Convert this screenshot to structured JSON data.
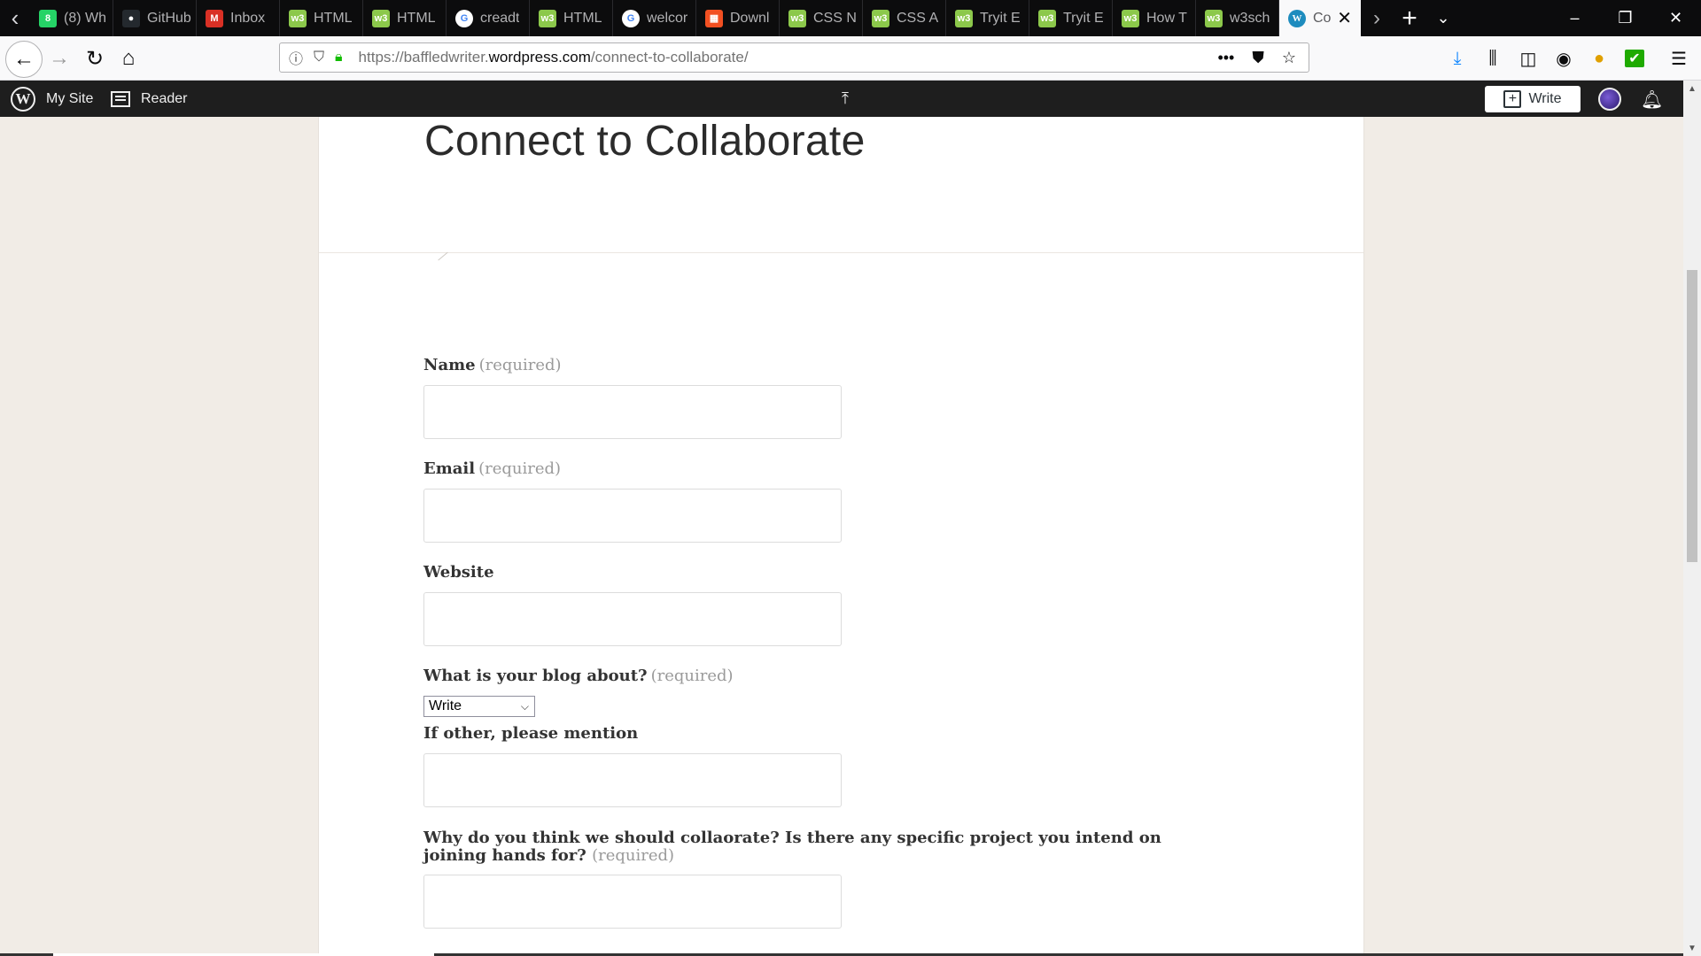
{
  "browser": {
    "tabs": [
      {
        "label": "(8) Wh",
        "icon": "whatsapp-icon",
        "color": "#25d366",
        "glyph": "8"
      },
      {
        "label": "GitHub",
        "icon": "github-icon",
        "color": "#24292e",
        "glyph": "●"
      },
      {
        "label": "Inbox",
        "icon": "gmail-icon",
        "color": "#d93025",
        "glyph": "M"
      },
      {
        "label": "HTML",
        "icon": "w3schools-icon",
        "color": "#8cc84b",
        "glyph": "w3"
      },
      {
        "label": "HTML",
        "icon": "w3schools-icon",
        "color": "#8cc84b",
        "glyph": "w3"
      },
      {
        "label": "creadt",
        "icon": "google-icon",
        "color": "#ffffff",
        "glyph": "G"
      },
      {
        "label": "HTML",
        "icon": "w3schools-icon",
        "color": "#8cc84b",
        "glyph": "w3"
      },
      {
        "label": "welcor",
        "icon": "google-icon",
        "color": "#ffffff",
        "glyph": "G"
      },
      {
        "label": "Downl",
        "icon": "microsoft-icon",
        "color": "#f25022",
        "glyph": "▦"
      },
      {
        "label": "CSS N",
        "icon": "w3schools-icon",
        "color": "#8cc84b",
        "glyph": "w3"
      },
      {
        "label": "CSS A",
        "icon": "w3schools-icon",
        "color": "#8cc84b",
        "glyph": "w3"
      },
      {
        "label": "Tryit E",
        "icon": "w3schools-icon",
        "color": "#8cc84b",
        "glyph": "w3"
      },
      {
        "label": "Tryit E",
        "icon": "w3schools-icon",
        "color": "#8cc84b",
        "glyph": "w3"
      },
      {
        "label": "How T",
        "icon": "w3schools-icon",
        "color": "#8cc84b",
        "glyph": "w3"
      },
      {
        "label": "w3sch",
        "icon": "w3schools-icon",
        "color": "#8cc84b",
        "glyph": "w3"
      }
    ],
    "active_tab": {
      "label": "Co",
      "icon": "wordpress-icon"
    },
    "url": {
      "scheme": "https://baffledwriter.",
      "host": "wordpress.com",
      "path": "/connect-to-collaborate/"
    }
  },
  "wpbar": {
    "my_site": "My Site",
    "reader": "Reader",
    "write": "Write"
  },
  "page": {
    "title": "Connect to Collaborate",
    "required_text": "(required)",
    "fields": {
      "name": "Name",
      "email": "Email",
      "website": "Website",
      "blog_about": "What is your blog about?",
      "blog_about_selected": "Write",
      "other": "If other, please mention",
      "why": "Why do you think we should collaorate? Is there any specific project you intend on joining hands for?"
    }
  }
}
